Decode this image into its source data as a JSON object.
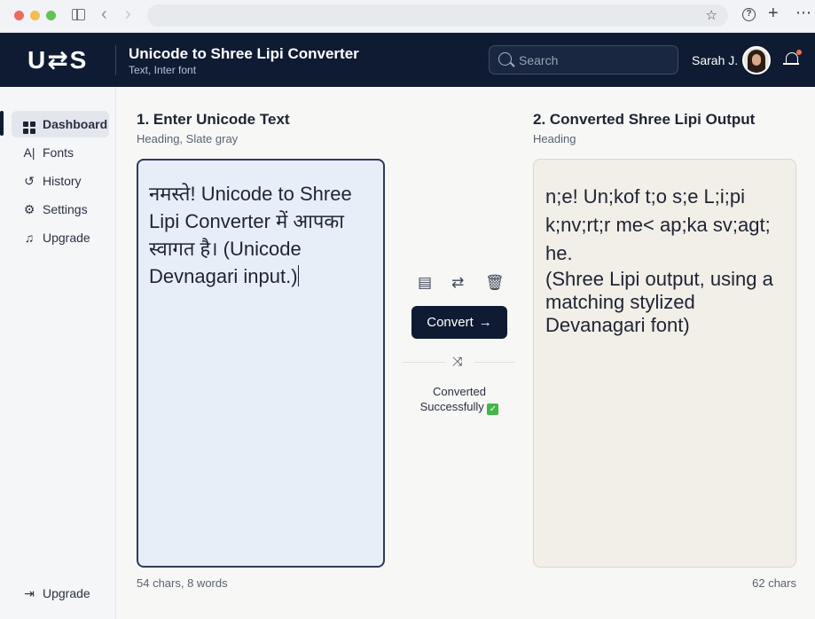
{
  "header": {
    "logo": "U⇄S",
    "title": "Unicode to Shree Lipi Converter",
    "subtitle": "Text, Inter font",
    "search_placeholder": "Search",
    "user_name": "Sarah J."
  },
  "sidebar": {
    "items": [
      {
        "label": "Dashboard",
        "icon": "dashboard-icon"
      },
      {
        "label": "Fonts",
        "icon": "fonts-icon"
      },
      {
        "label": "History",
        "icon": "history-icon"
      },
      {
        "label": "Settings",
        "icon": "gear-icon"
      },
      {
        "label": "Upgrade",
        "icon": "bell-icon"
      }
    ],
    "bottom_label": "Upgrade"
  },
  "input_panel": {
    "title": "1. Enter Unicode Text",
    "subtitle": "Heading, Slate gray",
    "text": "नमस्ते! Unicode to Shree Lipi Converter में आपका स्वागत है। (Unicode Devnagari input.)",
    "counter": "54 chars, 8 words"
  },
  "output_panel": {
    "title": "2. Converted Shree Lipi Output",
    "subtitle": "Heading",
    "text": "n;e! Un;kof t;o s;e L;i;pi k;nv;rt;r me< ap;ka sv;agt; he.",
    "note": "(Shree Lipi output, using a matching stylized Devanagari font)",
    "counter": "62 chars"
  },
  "actions": {
    "convert_label": "Convert",
    "status": "Converted Successfully",
    "status_icon": "check-icon"
  },
  "colors": {
    "header_bg": "#0f1b33",
    "input_bg": "#e8eef8",
    "output_bg": "#f2eee8",
    "accent": "#0f1b33",
    "success": "#43b649"
  }
}
